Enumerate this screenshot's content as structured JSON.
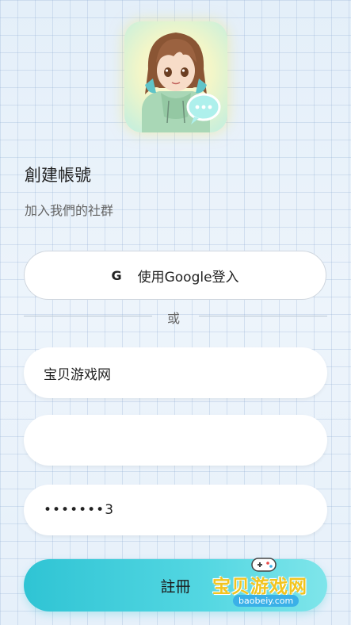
{
  "header": {
    "title": "創建帳號",
    "subtitle": "加入我們的社群"
  },
  "google_button": {
    "icon_letter": "G",
    "label": "使用Google登入"
  },
  "divider": {
    "text": "或"
  },
  "form": {
    "username_value": "宝贝游戏网",
    "email_value": "",
    "password_value": "•••••••3"
  },
  "register_button": {
    "label": "註冊"
  },
  "watermark": {
    "text": "宝贝游戏网",
    "url": "baobeiy.com"
  },
  "colors": {
    "accent": "#2fc4d4",
    "background": "#e9f2fa",
    "watermark_yellow": "#f2c41f"
  },
  "icons": {
    "avatar": "anime-girl-avatar-icon",
    "chat_bubble": "chat-bubble-icon",
    "google": "google-icon",
    "watermark_gamepad": "gamepad-icon"
  }
}
